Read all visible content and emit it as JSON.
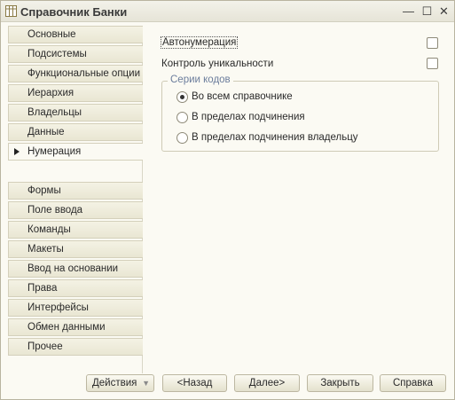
{
  "window": {
    "title": "Справочник Банки",
    "icon": "table-icon",
    "controls": {
      "minimize": "—",
      "maximize": "☐",
      "close": "✕"
    }
  },
  "sidebar": {
    "items": [
      {
        "label": "Основные"
      },
      {
        "label": "Подсистемы"
      },
      {
        "label": "Функциональные опции"
      },
      {
        "label": "Иерархия"
      },
      {
        "label": "Владельцы"
      },
      {
        "label": "Данные"
      },
      {
        "label": "Нумерация"
      },
      {
        "label": "Формы"
      },
      {
        "label": "Поле ввода"
      },
      {
        "label": "Команды"
      },
      {
        "label": "Макеты"
      },
      {
        "label": "Ввод на основании"
      },
      {
        "label": "Права"
      },
      {
        "label": "Интерфейсы"
      },
      {
        "label": "Обмен данными"
      },
      {
        "label": "Прочее"
      }
    ],
    "active": "Нумерация"
  },
  "numbering": {
    "autonumbering_label": "Автонумерация",
    "autonumbering_checked": false,
    "uniqueness_label": "Контроль уникальности",
    "uniqueness_checked": false,
    "series_group_title": "Серии кодов",
    "series_options": [
      {
        "label": "Во всем справочнике",
        "selected": true
      },
      {
        "label": "В пределах подчинения",
        "selected": false
      },
      {
        "label": "В пределах подчинения владельцу",
        "selected": false
      }
    ]
  },
  "footer": {
    "actions_label": "Действия",
    "back_label": "<Назад",
    "next_label": "Далее>",
    "close_label": "Закрыть",
    "help_label": "Справка"
  },
  "colors": {
    "window_bg": "#fbfaf3",
    "tab_bg": "#ece9d8",
    "group_title": "#6b7d9c"
  }
}
